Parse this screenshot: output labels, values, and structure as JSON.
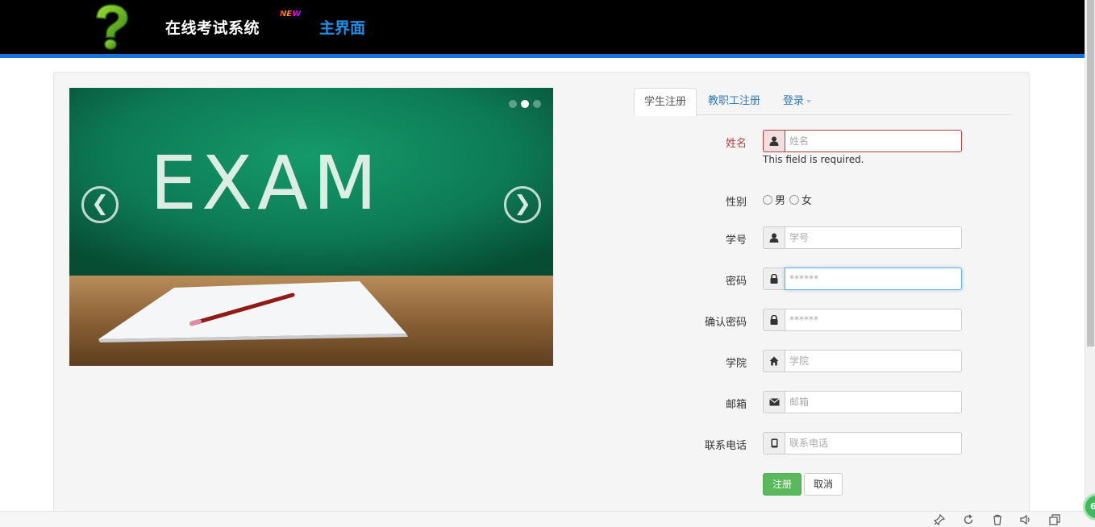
{
  "header": {
    "logo_icon": "question-mark-logo",
    "brand": "在线考试系统",
    "new_badge": "NEW",
    "nav_home": "主界面"
  },
  "carousel": {
    "image_text": "EXAM",
    "prev_label": "❮",
    "next_label": "❯",
    "slide_count": 3,
    "active_slide": 2
  },
  "tabs": [
    {
      "label": "学生注册",
      "active": true
    },
    {
      "label": "教职工注册",
      "active": false
    },
    {
      "label": "登录",
      "active": false,
      "dropdown": true
    }
  ],
  "form": {
    "name": {
      "label": "姓名",
      "placeholder": "姓名",
      "value": "",
      "error": "This field is required.",
      "icon": "user-icon"
    },
    "gender": {
      "label": "性别",
      "options": [
        "男",
        "女"
      ]
    },
    "student_id": {
      "label": "学号",
      "placeholder": "学号",
      "icon": "user-icon"
    },
    "password": {
      "label": "密码",
      "placeholder": "******",
      "icon": "lock-icon"
    },
    "confirm_password": {
      "label": "确认密码",
      "placeholder": "******",
      "icon": "lock-icon"
    },
    "college": {
      "label": "学院",
      "placeholder": "学院",
      "icon": "home-icon"
    },
    "email": {
      "label": "邮箱",
      "placeholder": "邮箱",
      "icon": "envelope-icon"
    },
    "phone": {
      "label": "联系电话",
      "placeholder": "联系电话",
      "icon": "phone-icon"
    },
    "submit_label": "注册",
    "cancel_label": "取消"
  },
  "bottombar": {
    "badge": "6"
  },
  "colors": {
    "header_bg": "#000000",
    "header_accent": "#1a73d9",
    "link": "#337ab7",
    "error": "#a94442",
    "success": "#5cb85c",
    "board_green": "#0f7a56"
  }
}
